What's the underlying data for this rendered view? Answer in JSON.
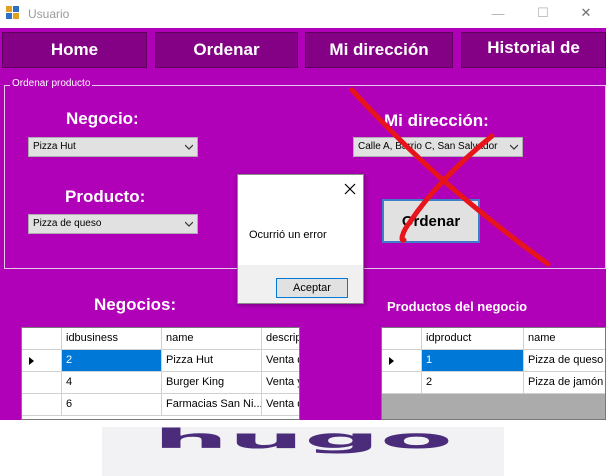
{
  "window": {
    "title": "Usuario",
    "minimize_glyph": "—",
    "maximize_glyph": "☐",
    "close_glyph": "✕"
  },
  "nav": {
    "home": "Home",
    "ordenar": "Ordenar",
    "mi_direccion": "Mi dirección",
    "historial": "Historial de"
  },
  "group": {
    "label": "Ordenar producto"
  },
  "form": {
    "negocio_label": "Negocio:",
    "negocio_value": "Pizza Hut",
    "producto_label": "Producto:",
    "producto_value": "Pizza de queso",
    "direccion_label": "Mi dirección:",
    "direccion_value": "Calle A, Barrio C, San Salvador",
    "ordenar_button": "Ordenar"
  },
  "negocios": {
    "heading": "Negocios:",
    "columns": [
      "idbusiness",
      "name",
      "descrip"
    ],
    "rows": [
      {
        "selected": true,
        "cells": [
          "2",
          "Pizza Hut",
          "Venta de"
        ]
      },
      {
        "selected": false,
        "cells": [
          "4",
          "Burger King",
          "Venta y"
        ]
      },
      {
        "selected": false,
        "cells": [
          "6",
          "Farmacias San Ni...",
          "Venta de"
        ]
      }
    ]
  },
  "productos": {
    "heading": "Productos del negocio",
    "columns": [
      "idproduct",
      "name"
    ],
    "rows": [
      {
        "selected": true,
        "cells": [
          "1",
          "Pizza de queso"
        ]
      },
      {
        "selected": false,
        "cells": [
          "2",
          "Pizza de jamón"
        ]
      }
    ]
  },
  "dialog": {
    "message": "Ocurrió un error",
    "ok_label": "Aceptar"
  },
  "colors": {
    "form_background": "#b000b8",
    "nav_button": "#840084",
    "red_x": "#e8141c",
    "logo_text": "#4a2c7a",
    "selection": "#0078d7"
  },
  "icons": [
    "app-icon",
    "minimize-icon",
    "maximize-icon",
    "close-icon",
    "dropdown-arrow-icon",
    "row-pointer-icon",
    "dialog-close-icon",
    "red-x-mark"
  ],
  "logo": {
    "text": "hugo"
  }
}
